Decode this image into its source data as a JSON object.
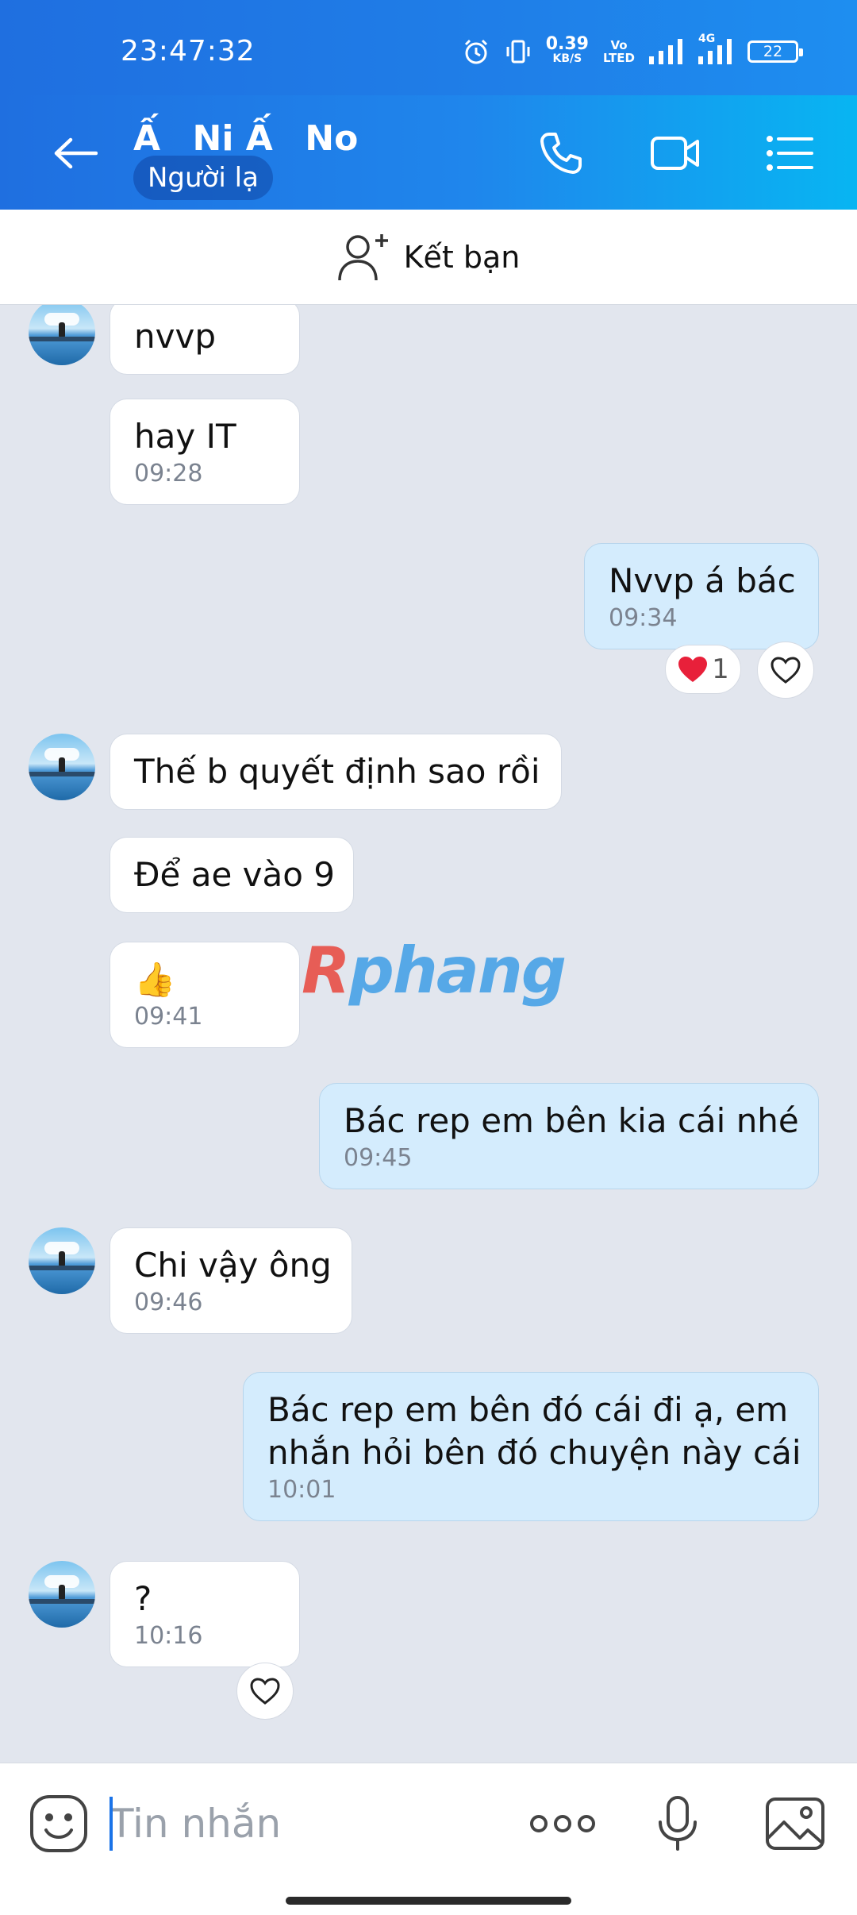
{
  "status_bar": {
    "time": "23:47:32",
    "net_speed_value": "0.39",
    "net_speed_unit": "KB/S",
    "volte_top": "Vo",
    "volte_bottom": "LTED",
    "network_type": "4G",
    "battery": "22",
    "icons": [
      "alarm-icon",
      "vibrate-icon",
      "signal-icon",
      "signal-4g-icon"
    ]
  },
  "header": {
    "contact_name": "ẤᅟNi ẤᅟNo",
    "badge": "Người lạ",
    "icons": [
      "back-arrow-icon",
      "phone-icon",
      "video-call-icon",
      "menu-list-icon"
    ]
  },
  "add_friend": {
    "label": "Kết bạn",
    "icon": "add-user-icon"
  },
  "messages": [
    {
      "from": "contact",
      "text": "nvvp",
      "time": ""
    },
    {
      "from": "contact",
      "text": "hay IT",
      "time": "09:28"
    },
    {
      "from": "me",
      "text": "Nvvp á bác",
      "time": "09:34",
      "reaction_count": "1"
    },
    {
      "from": "contact",
      "text": "Thế b quyết định sao rồi",
      "time": ""
    },
    {
      "from": "contact",
      "text": "Để ae vào 9",
      "time": ""
    },
    {
      "from": "contact",
      "text": "👍",
      "time": "09:41"
    },
    {
      "from": "me",
      "text": "Bác rep em bên kia cái nhé",
      "time": "09:45"
    },
    {
      "from": "contact",
      "text": "Chi vậy ông",
      "time": "09:46"
    },
    {
      "from": "me",
      "text_line1": "Bác rep em bên đó cái đi ạ, em",
      "text_line2": "nhắn hỏi bên đó chuyện này cái",
      "time": "10:01"
    },
    {
      "from": "contact",
      "text": "?",
      "time": "10:16"
    }
  ],
  "watermark": {
    "r": "R",
    "rest": "phang"
  },
  "composer": {
    "placeholder": "Tin nhắn",
    "icons": [
      "emoji-sticker-icon",
      "more-dots-icon",
      "microphone-icon",
      "image-gallery-icon"
    ]
  },
  "colors": {
    "header_start": "#1f6fe0",
    "header_end": "#08b5f2",
    "chat_bg": "#e2e6ee",
    "outgoing_bubble": "#d4ecfd",
    "incoming_bubble": "#ffffff",
    "heart": "#e8203a"
  }
}
